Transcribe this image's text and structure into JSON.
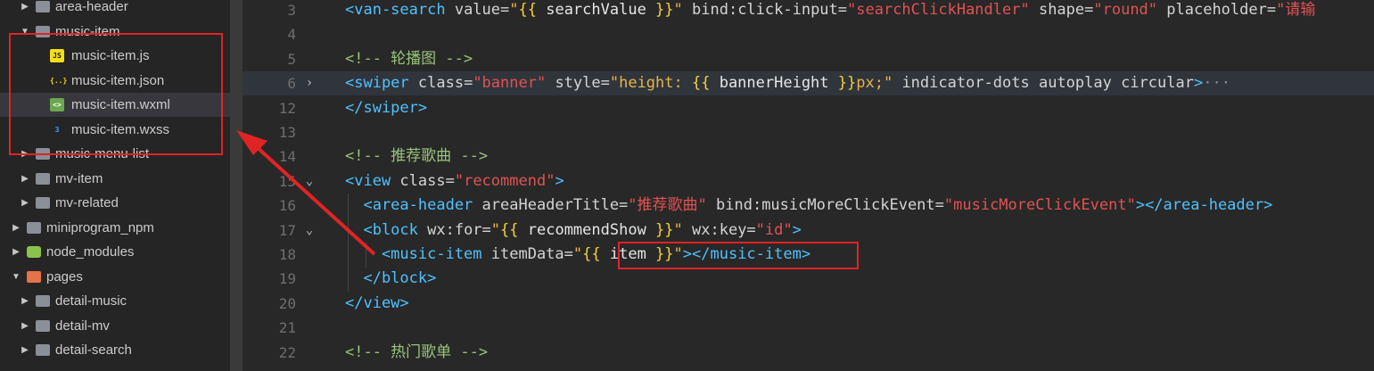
{
  "explorer": {
    "items": [
      {
        "label": "area-header",
        "kind": "folder",
        "expanded": false
      },
      {
        "label": "music-item",
        "kind": "folder",
        "expanded": true
      },
      {
        "label": "music-item.js",
        "kind": "js",
        "badge": "JS"
      },
      {
        "label": "music-item.json",
        "kind": "json",
        "badge": "{..}"
      },
      {
        "label": "music-item.wxml",
        "kind": "wxml",
        "badge": "<>",
        "selected": true
      },
      {
        "label": "music-item.wxss",
        "kind": "wxss",
        "badge": "3"
      },
      {
        "label": "music-menu-list",
        "kind": "folder",
        "expanded": false
      },
      {
        "label": "mv-item",
        "kind": "folder",
        "expanded": false
      },
      {
        "label": "mv-related",
        "kind": "folder",
        "expanded": false
      },
      {
        "label": "miniprogram_npm",
        "kind": "folder",
        "expanded": false
      },
      {
        "label": "node_modules",
        "kind": "node-folder",
        "expanded": false
      },
      {
        "label": "pages",
        "kind": "pages-folder",
        "expanded": true
      },
      {
        "label": "detail-music",
        "kind": "folder",
        "expanded": false
      },
      {
        "label": "detail-mv",
        "kind": "folder",
        "expanded": false
      },
      {
        "label": "detail-search",
        "kind": "folder",
        "expanded": false
      }
    ]
  },
  "editor": {
    "lines": [
      {
        "num": "3",
        "fold": "",
        "tokens": [
          {
            "t": "<van-search",
            "c": "tag"
          },
          {
            "t": " value=",
            "c": "attr"
          },
          {
            "t": "\"",
            "c": "str"
          },
          {
            "t": "{{",
            "c": "brace"
          },
          {
            "t": " searchValue ",
            "c": "id"
          },
          {
            "t": "}}",
            "c": "brace"
          },
          {
            "t": "\"",
            "c": "str"
          },
          {
            "t": " bind:click-input=",
            "c": "attr"
          },
          {
            "t": "\"searchClickHandler\"",
            "c": "red"
          },
          {
            "t": " shape=",
            "c": "attr"
          },
          {
            "t": "\"round\"",
            "c": "red"
          },
          {
            "t": " placeholder=",
            "c": "attr"
          },
          {
            "t": "\"请输",
            "c": "red"
          }
        ]
      },
      {
        "num": "4",
        "fold": "",
        "tokens": []
      },
      {
        "num": "5",
        "fold": "",
        "tokens": [
          {
            "t": "<!-- 轮播图 -->",
            "c": "cmt"
          }
        ]
      },
      {
        "num": "6",
        "fold": "›",
        "active": true,
        "tokens": [
          {
            "t": "<swiper",
            "c": "tag"
          },
          {
            "t": " class=",
            "c": "attr"
          },
          {
            "t": "\"banner\"",
            "c": "red"
          },
          {
            "t": " style=",
            "c": "attr"
          },
          {
            "t": "\"height: ",
            "c": "str"
          },
          {
            "t": "{{",
            "c": "brace"
          },
          {
            "t": " bannerHeight ",
            "c": "id"
          },
          {
            "t": "}}",
            "c": "brace"
          },
          {
            "t": "px;\"",
            "c": "str"
          },
          {
            "t": " indicator-dots autoplay circular",
            "c": "attr"
          },
          {
            "t": ">",
            "c": "tag"
          },
          {
            "t": "···",
            "c": "dim"
          }
        ]
      },
      {
        "num": "12",
        "fold": "",
        "tokens": [
          {
            "t": "</swiper>",
            "c": "tag"
          }
        ]
      },
      {
        "num": "13",
        "fold": "",
        "tokens": []
      },
      {
        "num": "14",
        "fold": "",
        "tokens": [
          {
            "t": "<!-- 推荐歌曲 -->",
            "c": "cmt"
          }
        ]
      },
      {
        "num": "15",
        "fold": "⌄",
        "tokens": [
          {
            "t": "<view",
            "c": "tag"
          },
          {
            "t": " class=",
            "c": "attr"
          },
          {
            "t": "\"recommend\"",
            "c": "red"
          },
          {
            "t": ">",
            "c": "tag"
          }
        ]
      },
      {
        "num": "16",
        "fold": "",
        "tokens": [
          {
            "t": "  <area-header",
            "c": "tag"
          },
          {
            "t": " areaHeaderTitle=",
            "c": "attr"
          },
          {
            "t": "\"推荐歌曲\"",
            "c": "red"
          },
          {
            "t": " bind:musicMoreClickEvent=",
            "c": "attr"
          },
          {
            "t": "\"musicMoreClickEvent\"",
            "c": "red"
          },
          {
            "t": "></area-header>",
            "c": "tag"
          }
        ]
      },
      {
        "num": "17",
        "fold": "⌄",
        "tokens": [
          {
            "t": "  <block",
            "c": "tag"
          },
          {
            "t": " wx:for=",
            "c": "attr"
          },
          {
            "t": "\"",
            "c": "str"
          },
          {
            "t": "{{",
            "c": "brace"
          },
          {
            "t": " recommendShow ",
            "c": "id"
          },
          {
            "t": "}}",
            "c": "brace"
          },
          {
            "t": "\"",
            "c": "str"
          },
          {
            "t": " wx:key=",
            "c": "attr"
          },
          {
            "t": "\"id\"",
            "c": "red"
          },
          {
            "t": ">",
            "c": "tag"
          }
        ]
      },
      {
        "num": "18",
        "fold": "",
        "tokens": [
          {
            "t": "    <music-item",
            "c": "tag"
          },
          {
            "t": " itemData=",
            "c": "attr"
          },
          {
            "t": "\"",
            "c": "str"
          },
          {
            "t": "{{",
            "c": "brace"
          },
          {
            "t": " item ",
            "c": "id"
          },
          {
            "t": "}}",
            "c": "brace"
          },
          {
            "t": "\"",
            "c": "str"
          },
          {
            "t": "></music-item>",
            "c": "tag"
          }
        ]
      },
      {
        "num": "19",
        "fold": "",
        "tokens": [
          {
            "t": "  </block>",
            "c": "tag"
          }
        ]
      },
      {
        "num": "20",
        "fold": "",
        "tokens": [
          {
            "t": "</view>",
            "c": "tag"
          }
        ]
      },
      {
        "num": "21",
        "fold": "",
        "tokens": []
      },
      {
        "num": "22",
        "fold": "",
        "tokens": [
          {
            "t": "<!-- 热门歌单 -->",
            "c": "cmt"
          }
        ]
      }
    ]
  },
  "colors": {
    "accent_red": "#e02424",
    "sidebar_bg": "#252526",
    "editor_bg": "#282828"
  }
}
